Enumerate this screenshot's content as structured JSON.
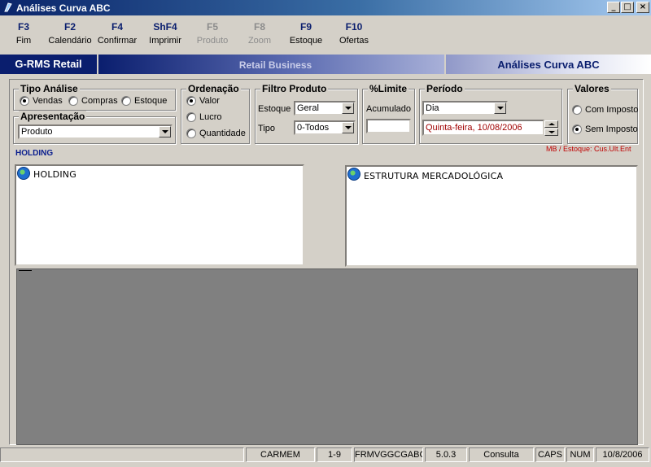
{
  "window": {
    "title": "Análises Curva ABC",
    "buttons": {
      "minimize": "_",
      "maximize": "□",
      "close": "×"
    }
  },
  "toolbar": {
    "keys": [
      {
        "key": "F3",
        "label": "Fim",
        "enabled": true
      },
      {
        "key": "F2",
        "label": "Calendário",
        "enabled": true
      },
      {
        "key": "F4",
        "label": "Confirmar",
        "enabled": true
      },
      {
        "key": "ShF4",
        "label": "Imprimir",
        "enabled": true
      },
      {
        "key": "F5",
        "label": "Produto",
        "enabled": false
      },
      {
        "key": "F8",
        "label": "Zoom",
        "enabled": false
      },
      {
        "key": "F9",
        "label": "Estoque",
        "enabled": true
      },
      {
        "key": "F10",
        "label": "Ofertas",
        "enabled": true
      }
    ]
  },
  "banner": {
    "app": "G-RMS Retail",
    "middle": "Retail Business",
    "module": "Análises Curva ABC"
  },
  "tipo_analise": {
    "title": "Tipo Análise",
    "options": [
      "Vendas",
      "Compras",
      "Estoque"
    ],
    "selected": "Vendas"
  },
  "apresentacao": {
    "title": "Apresentação",
    "value": "Produto"
  },
  "ordenacao": {
    "title": "Ordenação",
    "options": [
      "Valor",
      "Lucro",
      "Quantidade"
    ],
    "selected": "Valor"
  },
  "filtro_produto": {
    "title": "Filtro Produto",
    "estoque_label": "Estoque",
    "estoque_value": "Geral",
    "tipo_label": "Tipo",
    "tipo_value": "0-Todos"
  },
  "limite": {
    "title": "%Limite",
    "acumulado_label": "Acumulado",
    "acumulado_value": ""
  },
  "periodo": {
    "title": "Período",
    "type_value": "Dia",
    "date_value": "Quinta-feira, 10/08/2006"
  },
  "valores": {
    "title": "Valores",
    "options": [
      "Com Imposto",
      "Sem Imposto"
    ],
    "selected": "Sem Imposto"
  },
  "notes": {
    "mb_estoque": "MB / Estoque: Cus.Ult.Ent",
    "holding_label": "HOLDING"
  },
  "tree_left": {
    "root": "HOLDING"
  },
  "tree_right": {
    "root": "ESTRUTURA MERCADOLÓGICA"
  },
  "statusbar": {
    "user": "CARMEM",
    "range": "1-9",
    "form": "FRMVGGCGABC",
    "version": "5.0.3",
    "mode": "Consulta",
    "caps": "CAPS",
    "num": "NUM",
    "date": "10/8/2006"
  },
  "colors": {
    "window_bg": "#d4d0c8",
    "title_dark": "#0a246a",
    "banner_dark": "#0a1e6e",
    "accent_red": "#c00000",
    "holding_blue": "#0a1e8e",
    "grey_area": "#808080"
  }
}
